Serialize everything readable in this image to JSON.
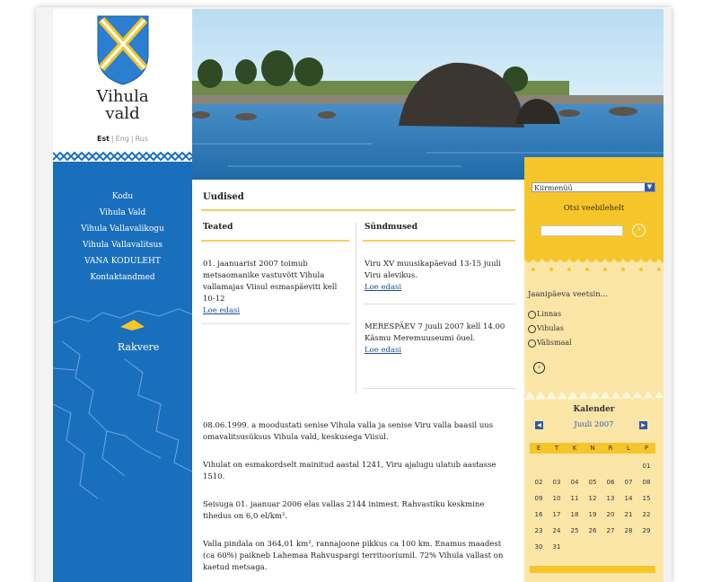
{
  "site": {
    "name_line1": "Vihula",
    "name_line2": "vald"
  },
  "languages": [
    "Est",
    "Eng",
    "Rus"
  ],
  "nav": {
    "items": [
      "Kodu",
      "Vihula Vald",
      "Vihula Vallavalikogu",
      "Vihula Vallavalitsus",
      "VANA KODULEHT",
      "Kontaktandmed"
    ]
  },
  "map": {
    "label": "Rakvere"
  },
  "main": {
    "title": "Uudised",
    "columns": [
      {
        "title": "Teated",
        "items": [
          {
            "text": "01. jaanuarist 2007 toimub metsaomanike vastuvõtt Vihula vallamajas Viisul esmaspäeviti kell 10-12",
            "more": "Loe edasi"
          }
        ]
      },
      {
        "title": "Sündmused",
        "items": [
          {
            "text": "Viru XV muusikapäevad 13-15 juuli Viru alevikus.",
            "more": "Loe edasi"
          },
          {
            "text": "MERESPÄEV 7 juuli 2007 kell 14.00 Käsmu Meremuuseumi õuel.",
            "more": "Loe edasi"
          }
        ]
      }
    ],
    "paragraphs": [
      "08.06.1999. a moodustati senise Vihula valla ja senise Viru valla baasil uus omavalitsusüksus Vihula vald, keskusega Viisul.",
      "Vihulat on esmakordselt mainitud aastal 1241, Viru ajalugu ulatub aastasse 1510.",
      "Seisuga 01. jaanuar 2006 elas vallas 2144 inimest. Rahvastiku keskmine tihedus on 6,0 el/km².",
      "Valla pindala on 364,01 km², rannajoone pikkus ca 100 km. Enamus maadest (ca 60%) paikneb Lahemaa Rahvuspargi territooriumil. 72% Vihula vallast on kaetud metsaga."
    ]
  },
  "sidebar": {
    "select_value": "Kiirmenüü",
    "search_label": "Otsi veebilehelt",
    "search_placeholder": "",
    "poll": {
      "question": "Jaanipäeva veetsin...",
      "options": [
        "Linnas",
        "Vihulas",
        "Välismaal"
      ]
    },
    "calendar": {
      "title": "Kalender",
      "month": "Juuli 2007",
      "weekdays": [
        "E",
        "T",
        "K",
        "N",
        "R",
        "L",
        "P"
      ],
      "weeks": [
        [
          "",
          "",
          "",
          "",
          "",
          "",
          "01"
        ],
        [
          "02",
          "03",
          "04",
          "05",
          "06",
          "07",
          "08"
        ],
        [
          "09",
          "10",
          "11",
          "12",
          "13",
          "14",
          "15"
        ],
        [
          "16",
          "17",
          "18",
          "19",
          "20",
          "21",
          "22"
        ],
        [
          "23",
          "24",
          "25",
          "26",
          "27",
          "28",
          "29"
        ],
        [
          "30",
          "31",
          "",
          "",
          "",
          "",
          ""
        ]
      ]
    }
  },
  "colors": {
    "blue": "#1a6fbd",
    "yellow": "#f6c52a",
    "light_yellow": "#fbe6a8"
  }
}
